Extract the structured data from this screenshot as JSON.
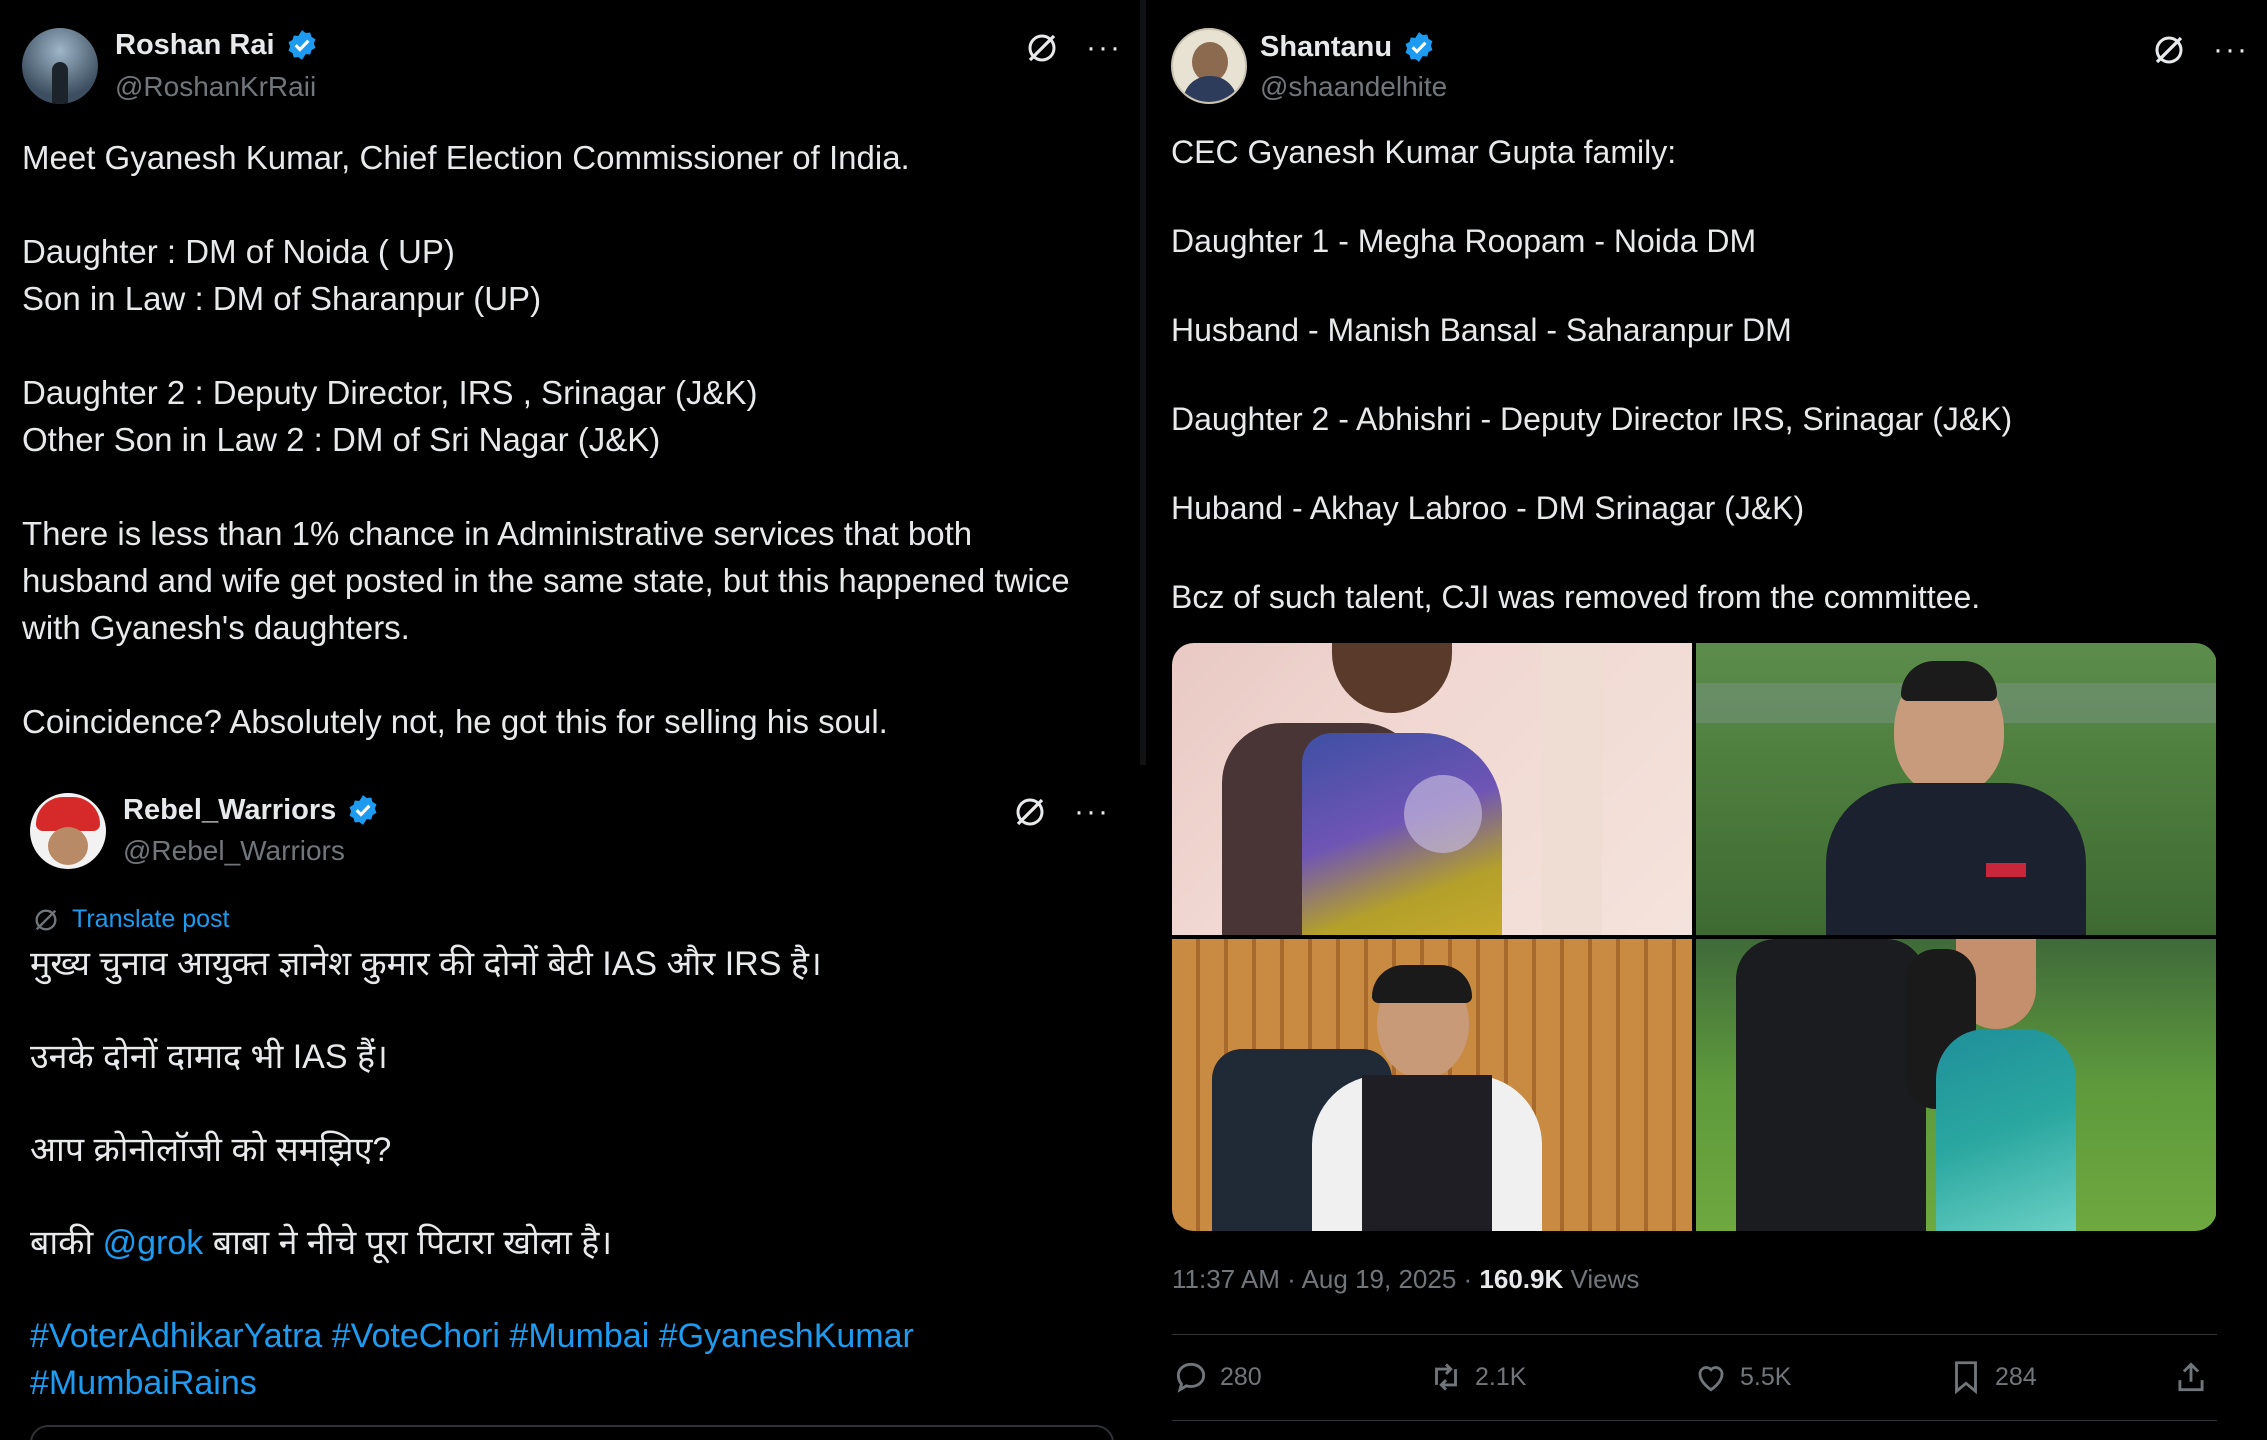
{
  "tweet1": {
    "name": "Roshan Rai",
    "handle": "@RoshanKrRaii",
    "lines": [
      "Meet Gyanesh Kumar, Chief Election Commissioner of India.",
      "",
      "Daughter : DM of Noida ( UP)",
      "Son in Law : DM of Sharanpur (UP)",
      "",
      "Daughter 2 : Deputy Director, IRS , Srinagar (J&K)",
      "Other Son in Law 2 : DM of Sri Nagar (J&K)",
      "",
      "There is less than 1% chance in Administrative services that both",
      "husband and wife get posted in the same state, but this happened twice",
      "with Gyanesh's daughters.",
      "",
      "Coincidence? Absolutely not, he got this for selling his soul."
    ]
  },
  "tweet2": {
    "name": "Rebel_Warriors",
    "handle": "@Rebel_Warriors",
    "translate_label": "Translate post",
    "line1": "मुख्य चुनाव आयुक्त ज्ञानेश कुमार की दोनों बेटी IAS और IRS है।",
    "line2": "उनके दोनों दामाद भी IAS हैं।",
    "line3": "आप क्रोनोलॉजी को समझिए?",
    "line4_pre": "बाकी ",
    "line4_mention": "@grok",
    "line4_post": " बाबा ने नीचे पूरा पिटारा खोला है।",
    "hashtags1": "#VoterAdhikarYatra #VoteChori #Mumbai #GyaneshKumar",
    "hashtags2": "#MumbaiRains"
  },
  "tweet3": {
    "name": "Shantanu",
    "handle": "@shaandelhite",
    "lines": [
      "CEC Gyanesh Kumar Gupta family:",
      "Daughter 1 - Megha Roopam  - Noida DM",
      "Husband - Manish Bansal - Saharanpur DM",
      "Daughter 2 - Abhishri - Deputy Director IRS, Srinagar (J&K)",
      "Huband - Akhay Labroo - DM Srinagar (J&K)",
      "Bcz of such talent, CJI was removed from the committee."
    ],
    "time": "11:37 AM · Aug 19, 2025 · ",
    "views_count": "160.9K",
    "views_label": " Views",
    "replies": "280",
    "reposts": "2.1K",
    "likes": "5.5K",
    "bookmarks": "284"
  },
  "colors": {
    "accent": "#1d9bf0",
    "muted": "#71767b",
    "text": "#e7e9ea",
    "background": "#000000"
  },
  "icons": [
    "verified-badge-icon",
    "grok-icon",
    "more-icon",
    "reply-icon",
    "repost-icon",
    "like-icon",
    "bookmark-icon",
    "share-icon"
  ]
}
